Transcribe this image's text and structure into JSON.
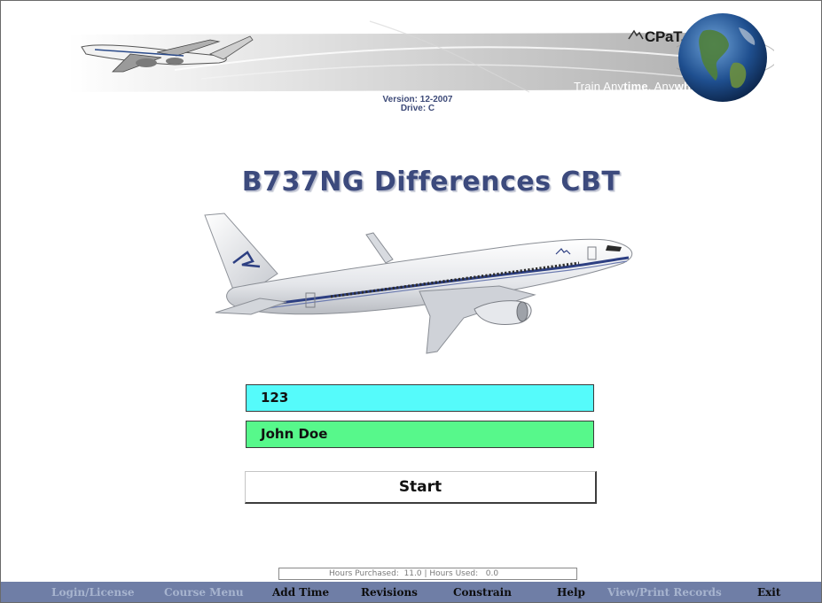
{
  "header": {
    "brand_name": "CPaT, Inc.",
    "tagline_prefix": "Train Any",
    "tagline_bold1": "time",
    "tagline_mid": ", Any",
    "tagline_bold2": "where",
    "version_line": "Version: 12-2007",
    "drive_line": "Drive: C"
  },
  "course": {
    "title": "B737NG Differences CBT"
  },
  "login": {
    "user_id": "123",
    "user_name": "John Doe",
    "start_label": "Start"
  },
  "hours": {
    "text": "Hours Purchased:  11.0 | Hours Used:   0.0"
  },
  "nav": {
    "items": [
      {
        "label": "Login/License",
        "enabled": false
      },
      {
        "label": "Course Menu",
        "enabled": false
      },
      {
        "label": "Add Time",
        "enabled": true
      },
      {
        "label": "Revisions",
        "enabled": true
      },
      {
        "label": "Constrain",
        "enabled": true
      },
      {
        "label": "Help",
        "enabled": true
      },
      {
        "label": "View/Print Records",
        "enabled": false
      },
      {
        "label": "Exit",
        "enabled": true
      }
    ]
  },
  "colors": {
    "nav_bar": "#6f7ea6",
    "nav_disabled": "#a7b4cf",
    "title": "#3c4a7d",
    "user_id_bg": "#55fbfb",
    "user_name_bg": "#57f88b"
  },
  "icons": [
    "jet-airliner-icon",
    "cpat-logo-icon",
    "globe-icon",
    "boeing-737-aircraft-icon"
  ]
}
